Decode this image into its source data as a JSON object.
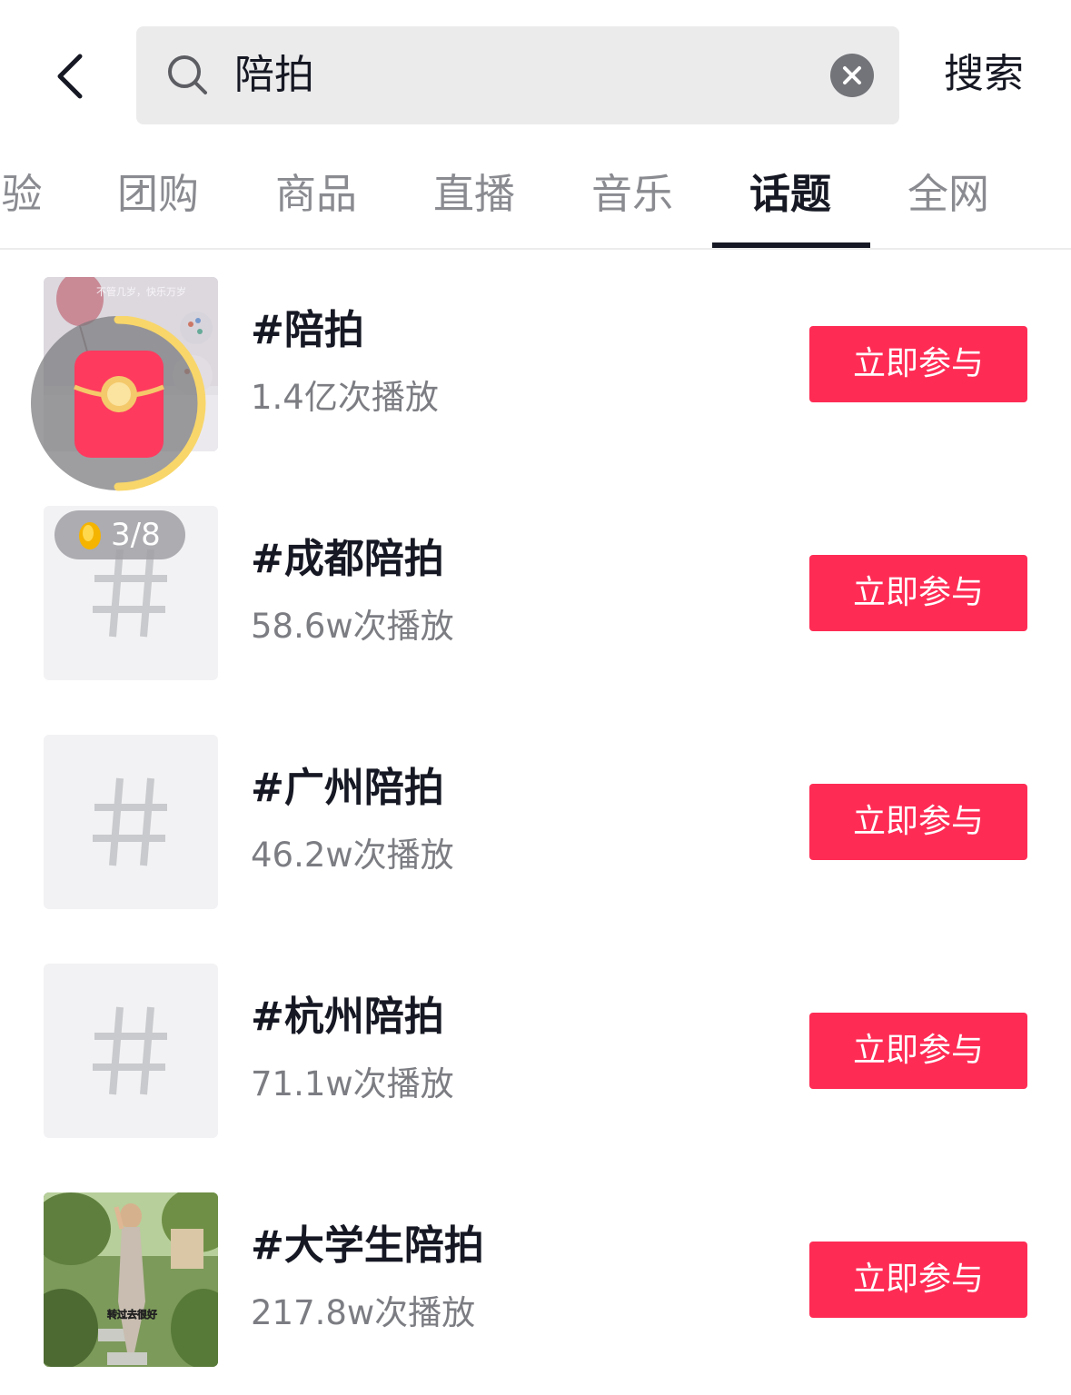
{
  "search": {
    "query": "陪拍",
    "action_label": "搜索"
  },
  "tabs": [
    {
      "label": "验"
    },
    {
      "label": "团购"
    },
    {
      "label": "商品"
    },
    {
      "label": "直播"
    },
    {
      "label": "音乐"
    },
    {
      "label": "话题"
    },
    {
      "label": "全网"
    }
  ],
  "active_tab": "话题",
  "topics": [
    {
      "title": "#陪拍",
      "plays": "1.4亿次播放",
      "button": "立即参与"
    },
    {
      "title": "#成都陪拍",
      "plays": "58.6w次播放",
      "button": "立即参与"
    },
    {
      "title": "#广州陪拍",
      "plays": "46.2w次播放",
      "button": "立即参与"
    },
    {
      "title": "#杭州陪拍",
      "plays": "71.1w次播放",
      "button": "立即参与"
    },
    {
      "title": "#大学生陪拍",
      "plays": "217.8w次播放",
      "button": "立即参与"
    }
  ],
  "reward_badge": {
    "count": "3/8"
  },
  "thumb_captions": {
    "first": "不管几岁，快乐万岁",
    "last": "转过去很好"
  },
  "colors": {
    "accent": "#fe2c55",
    "text_primary": "#161823",
    "text_secondary": "#7c7d83",
    "search_bg": "#ebebec"
  }
}
